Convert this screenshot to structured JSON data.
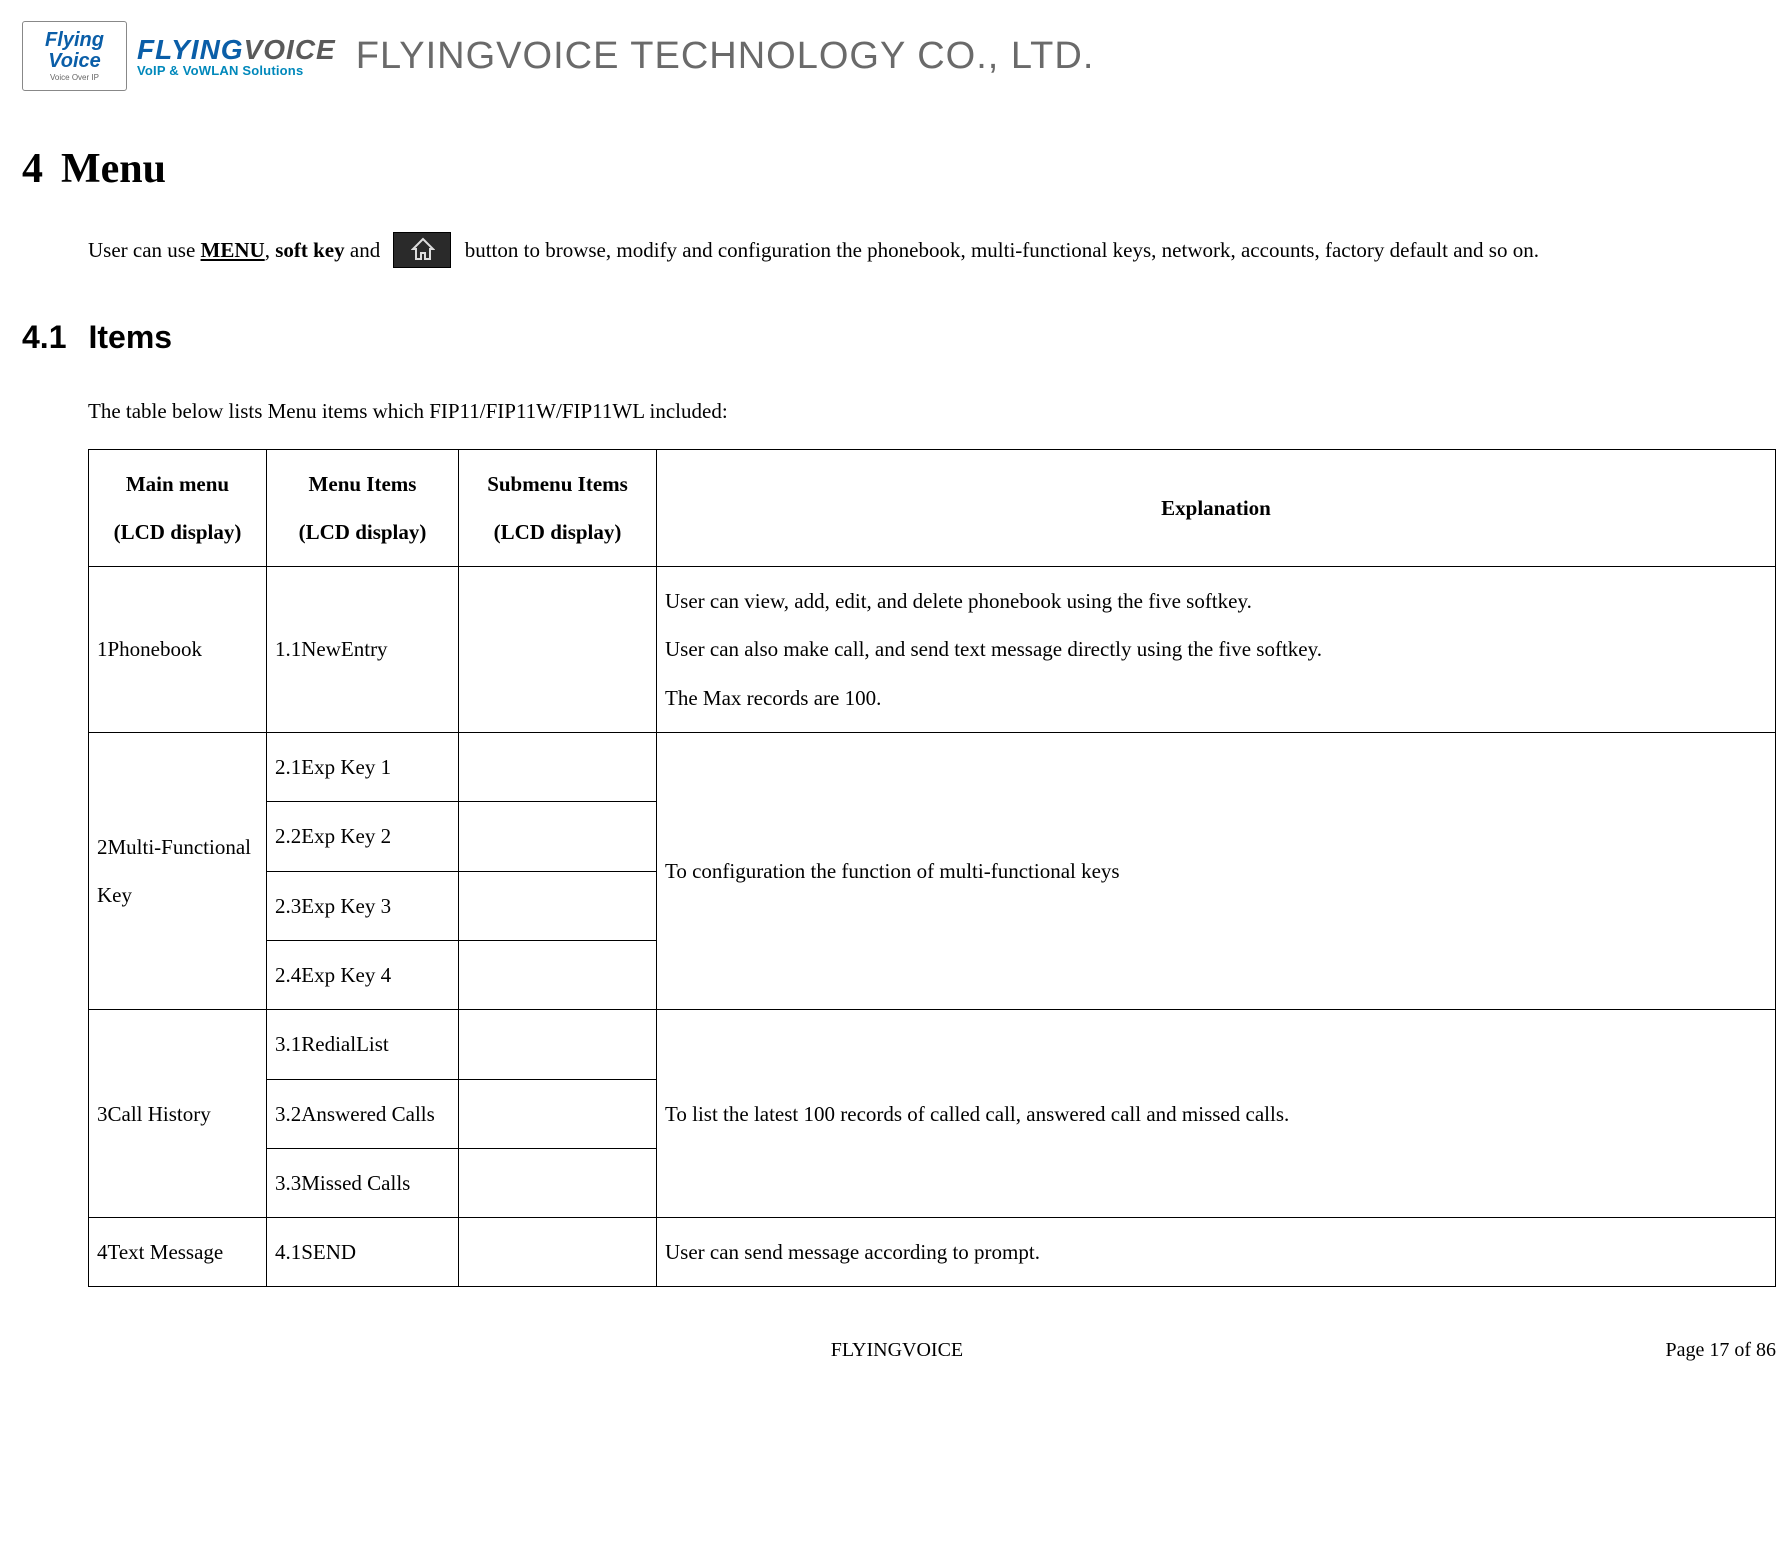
{
  "logo": {
    "mark_top": "Flying",
    "mark_bot": "Voice",
    "mark_sub": "Voice Over IP",
    "word_fly": "FLYING",
    "word_voice": "VOICE",
    "word_sub": "VoIP & VoWLAN Solutions"
  },
  "company_name": "FLYINGVOICE TECHNOLOGY CO., LTD.",
  "h1": {
    "num": "4",
    "title": "Menu"
  },
  "intro": {
    "prefix": "User can use ",
    "menu": "MENU",
    "sep1": ", ",
    "softkey": "soft key",
    "sep2": " and ",
    "suffix": " button to browse, modify and configuration the phonebook, multi-functional keys, network, accounts, factory default and so on."
  },
  "h2": {
    "num": "4.1",
    "title": "Items"
  },
  "items_intro": "The table below lists Menu items which FIP11/FIP11W/FIP11WL included:",
  "table": {
    "headers": {
      "c1a": "Main menu",
      "c1b": "(LCD display)",
      "c2a": "Menu Items",
      "c2b": "(LCD display)",
      "c3a": "Submenu Items",
      "c3b": "(LCD display)",
      "c4": "Explanation"
    },
    "r1": {
      "main": "1Phonebook",
      "item": "1.1NewEntry",
      "sub": "",
      "exp_l1": "User can view, add, edit, and delete phonebook using the five softkey.",
      "exp_l2": "User can also make call, and send text message directly using the five softkey.",
      "exp_l3": "The Max records are 100."
    },
    "r2": {
      "main": "2Multi-Functional Key",
      "i1": "2.1Exp Key 1",
      "i2": "2.2Exp Key 2",
      "i3": "2.3Exp Key 3",
      "i4": "2.4Exp Key 4",
      "exp": "To configuration the function of multi-functional keys"
    },
    "r3": {
      "main": "3Call History",
      "i1": "3.1RedialList",
      "i2": "3.2Answered Calls",
      "i3": "3.3Missed Calls",
      "exp": "To list the latest 100 records of called call, answered call and missed calls."
    },
    "r4": {
      "main": "4Text Message",
      "item": "4.1SEND",
      "sub": "",
      "exp": "User can send message according to prompt."
    }
  },
  "footer": {
    "center": "FLYINGVOICE",
    "right": "Page  17  of  86"
  }
}
